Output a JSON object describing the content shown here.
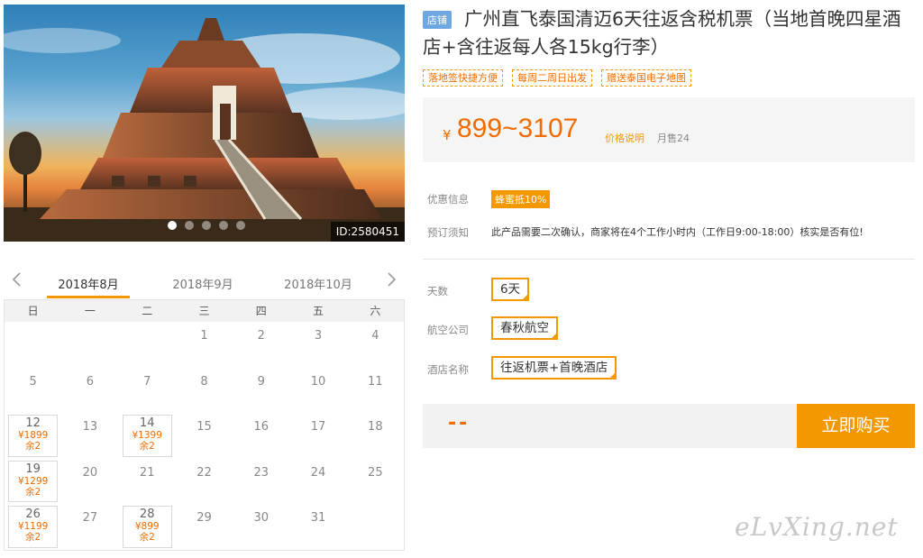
{
  "product": {
    "badge": "店铺",
    "title": "广州直飞泰国清迈6天往返含税机票（当地首晚四星酒店+含往返每人各15kg行李）",
    "tags": [
      "落地签快捷方便",
      "每周二周日出发",
      "赠送泰国电子地图"
    ],
    "image_id": "ID:2580451"
  },
  "price": {
    "currency": "¥",
    "range": "899~3107",
    "explain_link": "价格说明",
    "monthly_sales": "月售24"
  },
  "info": {
    "discount_label": "优惠信息",
    "discount_badge": "蜂蜜抵10%",
    "notice_label": "预订须知",
    "notice_text": "此产品需要二次确认，商家将在4个工作小时内（工作日9:00-18:00）核实是否有位!"
  },
  "options": {
    "days_label": "天数",
    "days_value": "6天",
    "airline_label": "航空公司",
    "airline_value": "春秋航空",
    "hotel_label": "酒店名称",
    "hotel_value": "往返机票+首晚酒店"
  },
  "buy": {
    "quantity_display": "--",
    "button": "立即购买"
  },
  "calendar": {
    "months": [
      "2018年8月",
      "2018年9月",
      "2018年10月"
    ],
    "active_month": 0,
    "weekdays": [
      "日",
      "一",
      "二",
      "三",
      "四",
      "五",
      "六"
    ],
    "weeks": [
      [
        null,
        null,
        null,
        {
          "d": "1"
        },
        {
          "d": "2"
        },
        {
          "d": "3"
        },
        {
          "d": "4"
        }
      ],
      [
        {
          "d": "5"
        },
        {
          "d": "6"
        },
        {
          "d": "7"
        },
        {
          "d": "8"
        },
        {
          "d": "9"
        },
        {
          "d": "10"
        },
        {
          "d": "11"
        }
      ],
      [
        {
          "d": "12",
          "price": "¥1899",
          "rem": "余2"
        },
        {
          "d": "13"
        },
        {
          "d": "14",
          "price": "¥1399",
          "rem": "余2"
        },
        {
          "d": "15"
        },
        {
          "d": "16"
        },
        {
          "d": "17"
        },
        {
          "d": "18"
        }
      ],
      [
        {
          "d": "19",
          "price": "¥1299",
          "rem": "余2"
        },
        {
          "d": "20"
        },
        {
          "d": "21"
        },
        {
          "d": "22"
        },
        {
          "d": "23"
        },
        {
          "d": "24"
        },
        {
          "d": "25"
        }
      ],
      [
        {
          "d": "26",
          "price": "¥1199",
          "rem": "余2"
        },
        {
          "d": "27"
        },
        {
          "d": "28",
          "price": "¥899",
          "rem": "余2"
        },
        {
          "d": "29"
        },
        {
          "d": "30"
        },
        {
          "d": "31"
        },
        null
      ]
    ]
  },
  "carousel": {
    "count": 5,
    "active": 0
  },
  "watermark": "eLvXing.net",
  "colors": {
    "accent": "#f39800",
    "price": "#f06c00",
    "badge": "#6fa7e0"
  }
}
